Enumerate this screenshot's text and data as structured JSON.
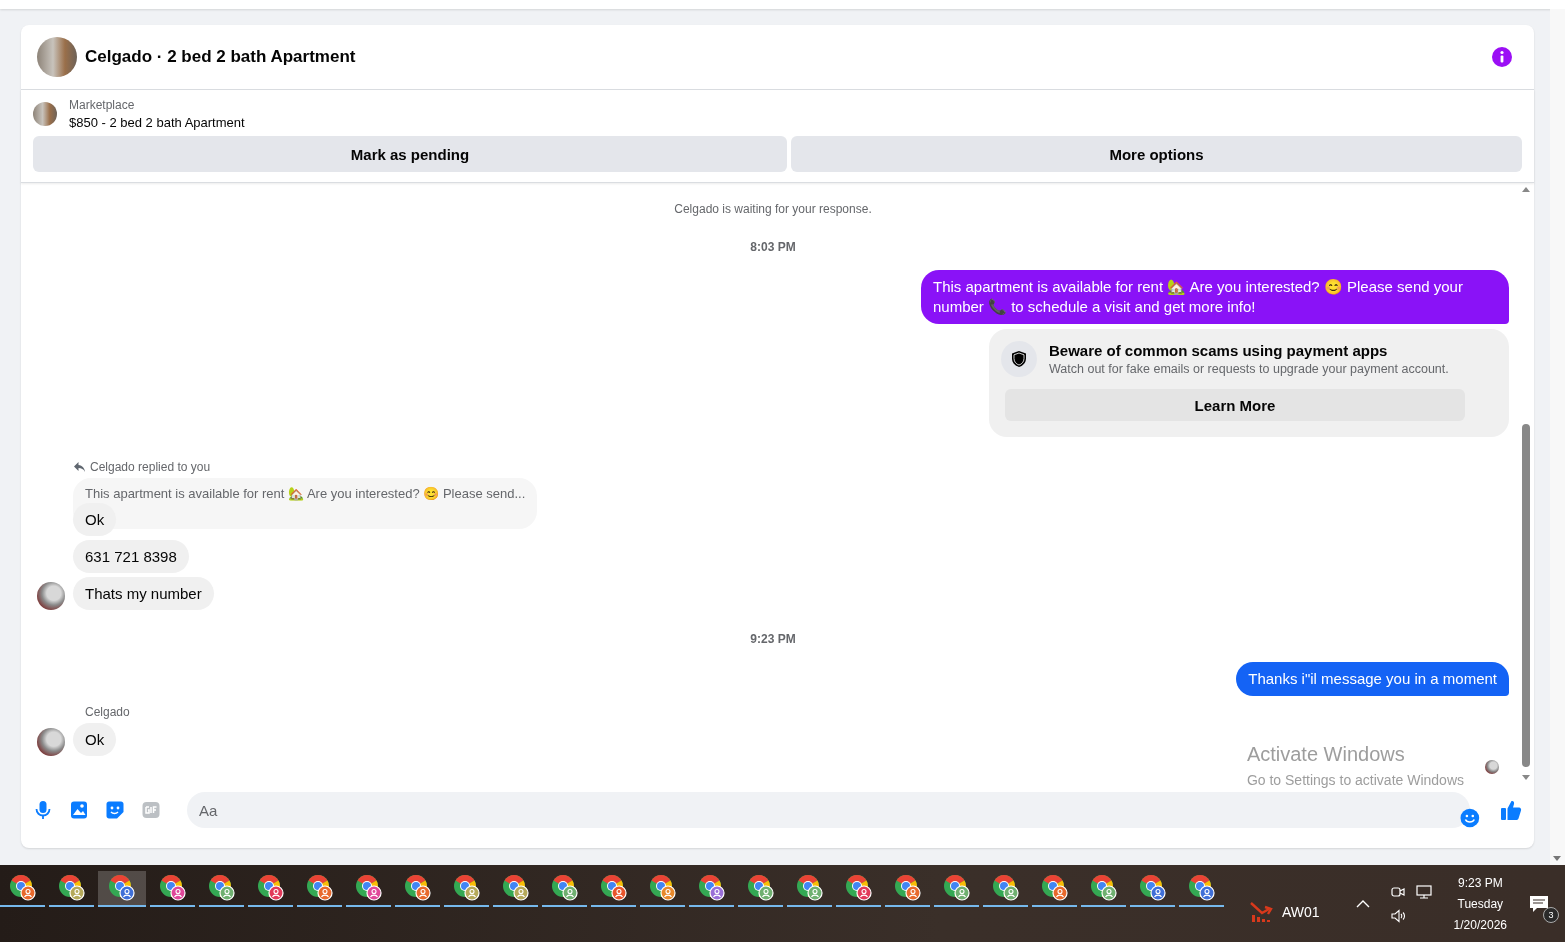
{
  "conversation": {
    "title": "Celgado · 2 bed 2 bath Apartment"
  },
  "listing": {
    "source": "Marketplace",
    "summary": "$850 - 2 bed 2 bath Apartment",
    "actions": [
      "Mark as pending",
      "More options"
    ]
  },
  "messages": [
    {
      "kind": "notice",
      "text": "Celgado is waiting for your response."
    },
    {
      "kind": "time",
      "text": "8:03 PM"
    },
    {
      "kind": "outgoing",
      "text": "This apartment is available for rent 🏡 Are you interested? 😊 Please send your number 📞 to schedule a visit and get more info!",
      "color": "#8a12f7"
    },
    {
      "kind": "safety",
      "title": "Beware of common scams using payment apps",
      "body": "Watch out for fake emails or requests to upgrade your payment account.",
      "action": "Learn More"
    },
    {
      "kind": "incoming",
      "reply_label": "Celgado replied to you",
      "quoted": "This apartment is available for rent 🏡 Are you interested? 😊 Please send...",
      "bubbles": [
        "Ok",
        "631 721 8398",
        "Thats my number"
      ]
    },
    {
      "kind": "time",
      "text": "9:23 PM"
    },
    {
      "kind": "outgoing",
      "text": "Thanks i\"il message you in a moment",
      "color": "#1463f5"
    },
    {
      "kind": "incoming",
      "sender": "Celgado",
      "bubbles": [
        "Ok"
      ]
    },
    {
      "kind": "seen"
    }
  ],
  "composer": {
    "placeholder": "Aa"
  },
  "os_notice": {
    "title": "Activate Windows",
    "subtitle": "Go to Settings to activate Windows"
  },
  "taskbar": {
    "apps": [
      {
        "color": "#e8692c",
        "selected": false
      },
      {
        "color": "#b5a95a",
        "selected": false
      },
      {
        "color": "#3f6fd8",
        "selected": true
      },
      {
        "color": "#e0489a",
        "selected": false
      },
      {
        "color": "#6fb070",
        "selected": false
      },
      {
        "color": "#e23a5a",
        "selected": false
      },
      {
        "color": "#e8692c",
        "selected": false
      },
      {
        "color": "#e0489a",
        "selected": false
      },
      {
        "color": "#e8692c",
        "selected": false
      },
      {
        "color": "#b5a95a",
        "selected": false
      },
      {
        "color": "#b5a95a",
        "selected": false
      },
      {
        "color": "#6fb070",
        "selected": false
      },
      {
        "color": "#e8552c",
        "selected": false
      },
      {
        "color": "#e8892c",
        "selected": false
      },
      {
        "color": "#9a6fd8",
        "selected": false
      },
      {
        "color": "#6fb070",
        "selected": false
      },
      {
        "color": "#6fb070",
        "selected": false
      },
      {
        "color": "#e23a5a",
        "selected": false
      },
      {
        "color": "#e8692c",
        "selected": false
      },
      {
        "color": "#6fb070",
        "selected": false
      },
      {
        "color": "#6fb070",
        "selected": false
      },
      {
        "color": "#e8692c",
        "selected": false
      },
      {
        "color": "#6fb070",
        "selected": false
      },
      {
        "color": "#3f6fd8",
        "selected": false
      },
      {
        "color": "#3f6fd8",
        "selected": false
      }
    ],
    "tray_app": "AW01",
    "time": "9:23 PM",
    "day": "Tuesday",
    "date": "1/20/2026",
    "notifications": "3"
  }
}
